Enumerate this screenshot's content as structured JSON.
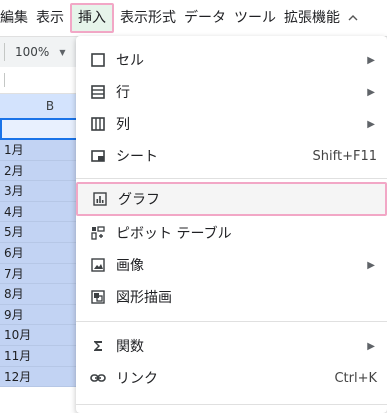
{
  "menubar": {
    "items": [
      "編集",
      "表示",
      "挿入",
      "表示形式",
      "データ",
      "ツール",
      "拡張機能"
    ],
    "active_index": 2,
    "more_icon": "chevron-right"
  },
  "toolbar": {
    "zoom_value": "100%"
  },
  "sheet": {
    "column_label": "B",
    "months": [
      "1月",
      "2月",
      "3月",
      "4月",
      "5月",
      "6月",
      "7月",
      "8月",
      "9月",
      "10月",
      "11月",
      "12月"
    ]
  },
  "insert_menu": {
    "items": [
      {
        "label": "セル",
        "icon": "cell-square",
        "submenu": true,
        "shortcut": ""
      },
      {
        "label": "行",
        "icon": "rows",
        "submenu": true,
        "shortcut": ""
      },
      {
        "label": "列",
        "icon": "columns",
        "submenu": true,
        "shortcut": ""
      },
      {
        "label": "シート",
        "icon": "sheet",
        "submenu": false,
        "shortcut": "Shift+F11"
      },
      {
        "label": "グラフ",
        "icon": "chart",
        "submenu": false,
        "shortcut": "",
        "highlighted": true
      },
      {
        "label": "ピボット テーブル",
        "icon": "pivot-table",
        "submenu": false,
        "shortcut": ""
      },
      {
        "label": "画像",
        "icon": "image",
        "submenu": true,
        "shortcut": ""
      },
      {
        "label": "図形描画",
        "icon": "drawing",
        "submenu": false,
        "shortcut": ""
      },
      {
        "label": "関数",
        "icon": "sigma",
        "submenu": true,
        "shortcut": ""
      },
      {
        "label": "リンク",
        "icon": "link",
        "submenu": false,
        "shortcut": "Ctrl+K"
      }
    ]
  },
  "colors": {
    "highlight_border": "#f2a7c6",
    "active_menu_bg": "#e6f4ea",
    "selection_blue": "#c2d3f3",
    "selected_cell_border": "#1a73e8"
  }
}
